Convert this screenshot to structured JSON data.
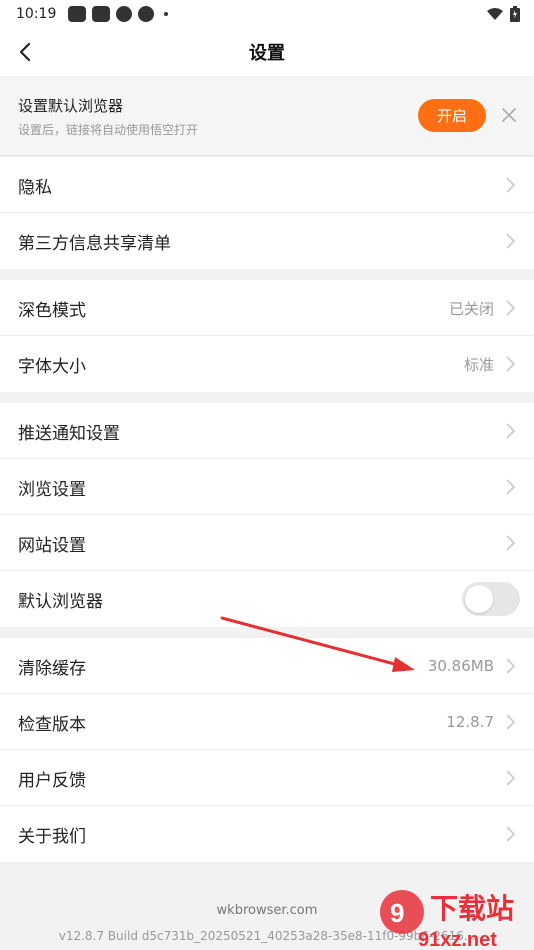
{
  "status_bar": {
    "time": "10:19"
  },
  "header": {
    "title": "设置",
    "back_icon": "back-arrow-icon"
  },
  "banner": {
    "title": "设置默认浏览器",
    "subtitle": "设置后，链接将自动使用悟空打开",
    "button_label": "开启",
    "accent": "#fd6f12"
  },
  "sections": {
    "privacy": {
      "label": "隐私"
    },
    "third_party": {
      "label": "第三方信息共享清单"
    },
    "dark_mode": {
      "label": "深色模式",
      "value": "已关闭"
    },
    "font_size": {
      "label": "字体大小",
      "value": "标准"
    },
    "push": {
      "label": "推送通知设置"
    },
    "browse": {
      "label": "浏览设置"
    },
    "site": {
      "label": "网站设置"
    },
    "default_browser": {
      "label": "默认浏览器",
      "enabled": false
    },
    "clear_cache": {
      "label": "清除缓存",
      "value": "30.86MB"
    },
    "check_version": {
      "label": "检查版本",
      "value": "12.8.7"
    },
    "feedback": {
      "label": "用户反馈"
    },
    "about": {
      "label": "关于我们"
    }
  },
  "footer": {
    "domain": "wkbrowser.com",
    "build": "v12.8.7 Build d5c731b_20250521_40253a28-35e8-11f0-99b6-2616..."
  },
  "watermark": {
    "text": "下载站",
    "domain": "91xz.net"
  }
}
